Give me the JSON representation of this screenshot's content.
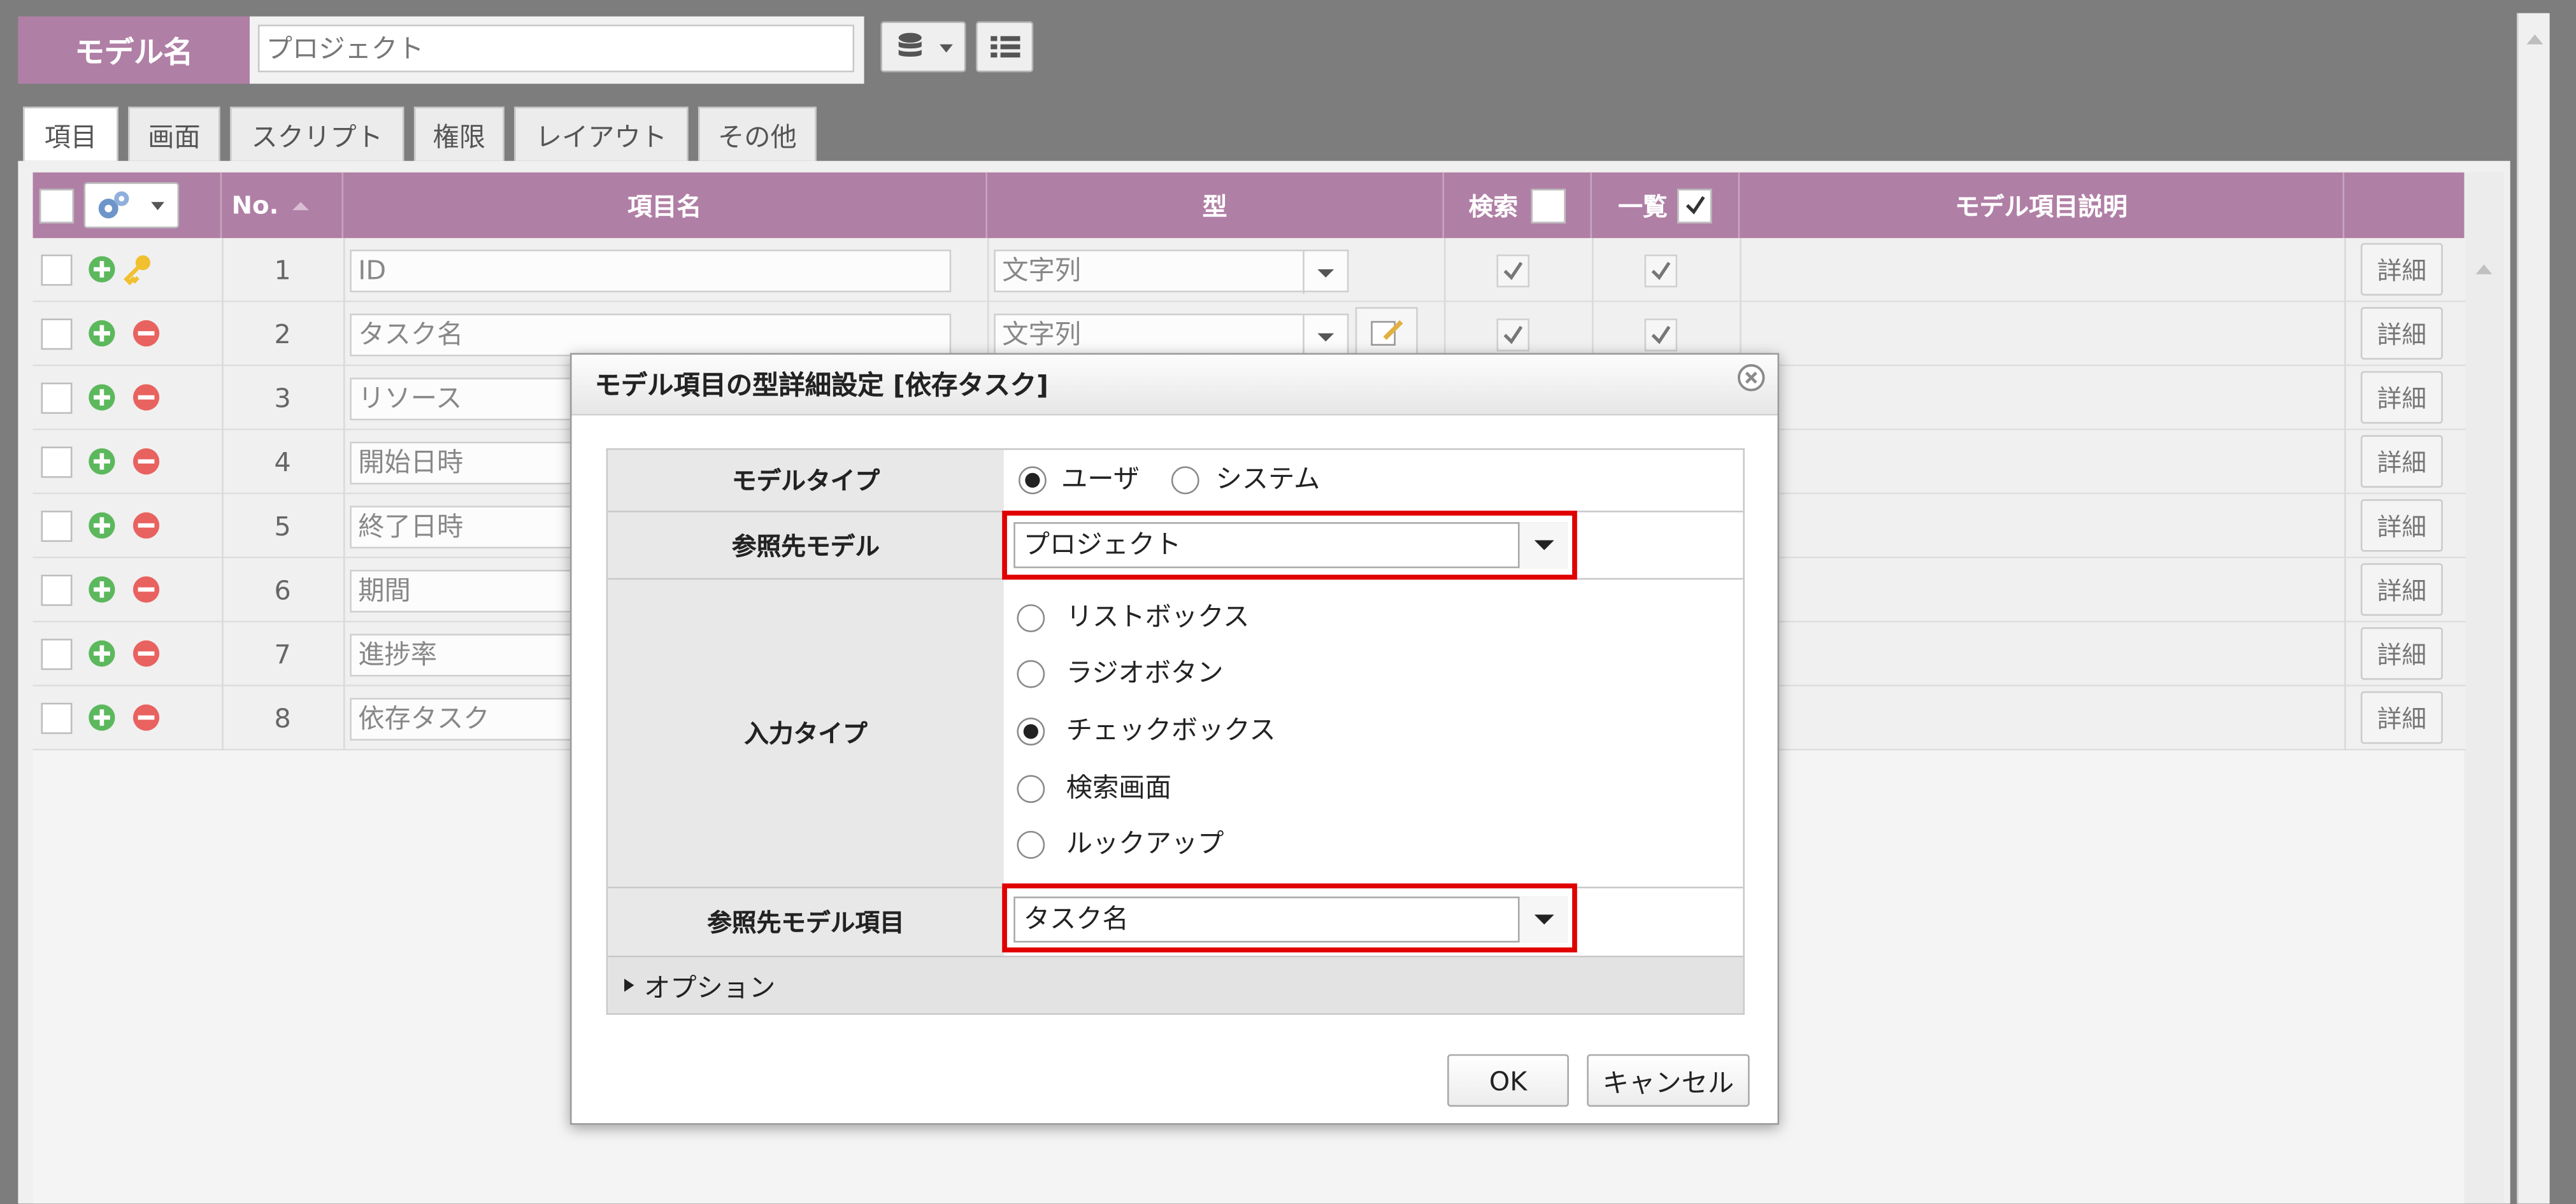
{
  "header": {
    "model_label": "モデル名",
    "model_name": "プロジェクト",
    "db_icon": "database-icon",
    "list_icon": "list-icon"
  },
  "tabs": [
    "項目",
    "画面",
    "スクリプト",
    "権限",
    "レイアウト",
    "その他"
  ],
  "grid": {
    "columns": {
      "no": "No.",
      "item_name": "項目名",
      "type": "型",
      "search": "検索",
      "list": "一覧",
      "description": "モデル項目説明"
    },
    "detail_label": "詳細",
    "rows": [
      {
        "no": "1",
        "name": "ID",
        "type": "文字列"
      },
      {
        "no": "2",
        "name": "タスク名",
        "type": "文字列"
      },
      {
        "no": "3",
        "name": "リソース"
      },
      {
        "no": "4",
        "name": "開始日時"
      },
      {
        "no": "5",
        "name": "終了日時"
      },
      {
        "no": "6",
        "name": "期間"
      },
      {
        "no": "7",
        "name": "進捗率"
      },
      {
        "no": "8",
        "name": "依存タスク"
      }
    ]
  },
  "dialog": {
    "title": "モデル項目の型詳細設定 [依存タスク]",
    "model_type_label": "モデルタイプ",
    "model_type_options": [
      "ユーザ",
      "システム"
    ],
    "model_type_selected": "ユーザ",
    "ref_model_label": "参照先モデル",
    "ref_model_value": "プロジェクト",
    "input_type_label": "入力タイプ",
    "input_type_options": [
      "リストボックス",
      "ラジオボタン",
      "チェックボックス",
      "検索画面",
      "ルックアップ"
    ],
    "input_type_selected": "チェックボックス",
    "ref_item_label": "参照先モデル項目",
    "ref_item_value": "タスク名",
    "options_label": "オプション",
    "ok_label": "OK",
    "cancel_label": "キャンセル"
  },
  "colors": {
    "header_purple": "#b07fa5",
    "highlight_red": "#e00000",
    "add_green": "#5cb85c",
    "remove_red": "#e8625f"
  }
}
